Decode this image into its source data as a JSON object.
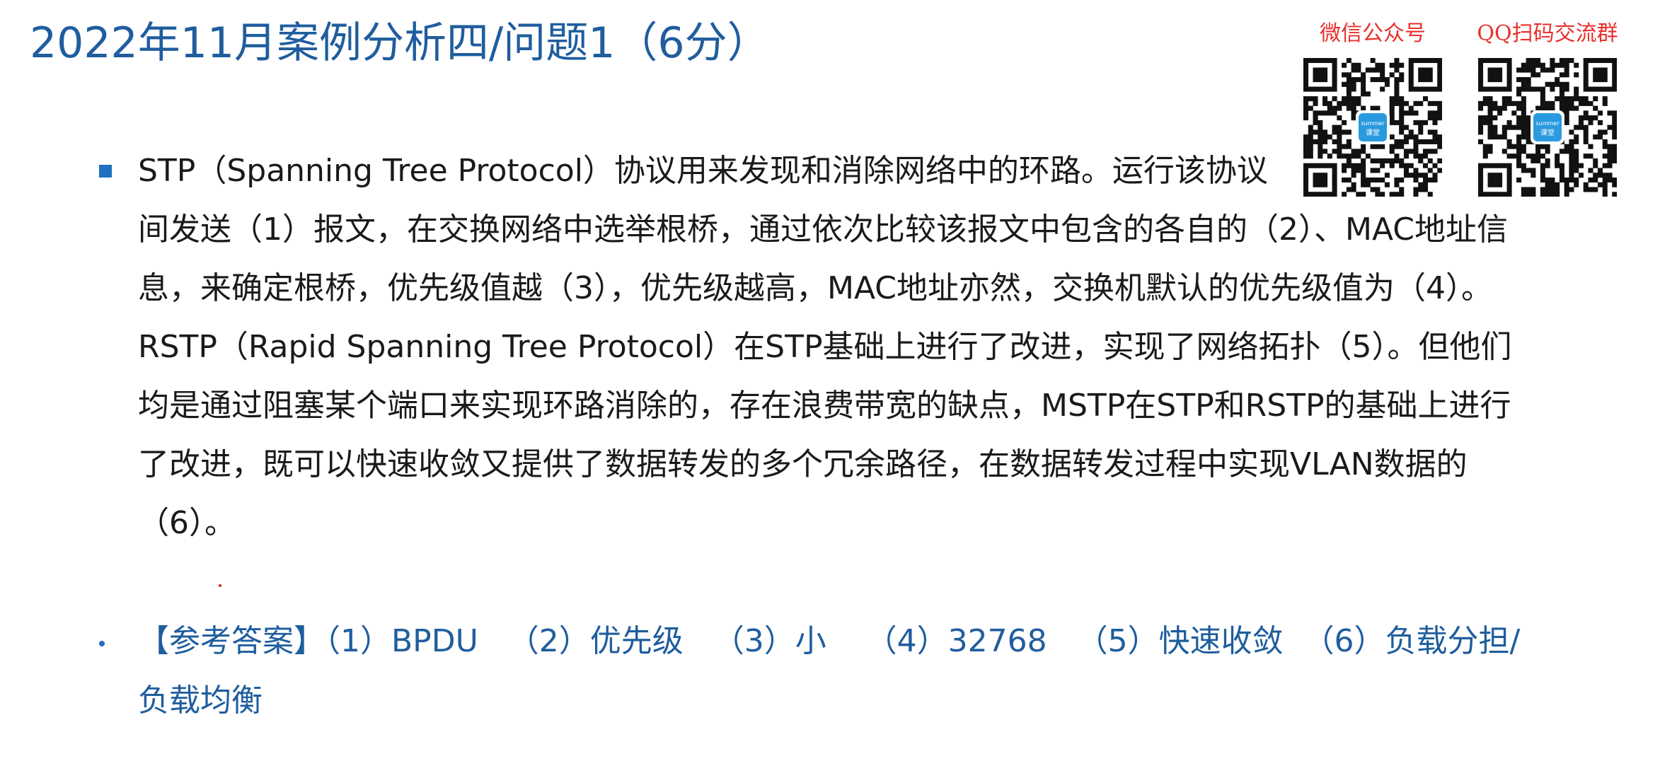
{
  "title": "2022年11月案例分析四/问题1（6分）",
  "qr_codes": [
    {
      "caption": "微信公众号",
      "badge": "summer 课堂",
      "icon": "qr-code-icon"
    },
    {
      "caption": "QQ扫码交流群",
      "badge": "summer 课堂",
      "icon": "qr-code-icon"
    }
  ],
  "question": {
    "lines": [
      "STP（Spanning Tree Protocol）协议用来发现和消除网络中的环路。运行该协议",
      "间发送（1）报文，在交换网络中选举根桥，通过依次比较该报文中包含的各自的（2）、MAC地址信",
      "息，来确定根桥，优先级值越（3），优先级越高，MAC地址亦然，交换机默认的优先级值为（4）。",
      "RSTP（Rapid Spanning Tree Protocol）在STP基础上进行了改进，实现了网络拓扑（5）。但他们",
      "均是通过阻塞某个端口来实现环路消除的，存在浪费带宽的缺点，MSTP在STP和RSTP的基础上进行",
      "了改进，既可以快速收敛又提供了数据转发的多个冗余路径，在数据转发过程中实现VLAN数据的",
      "（6）。"
    ]
  },
  "answer": {
    "lines": [
      "【参考答案】（1）BPDU   （2）优先级   （3）小    （4）32768   （5）快速收敛  （6）负载分担/",
      "负载均衡"
    ]
  },
  "colors": {
    "title": "#1f5d9e",
    "bullet": "#1f70c0",
    "answer": "#1f5d9e",
    "qr_caption": "#e8302c",
    "qr_badge": "#2a9ae0"
  }
}
